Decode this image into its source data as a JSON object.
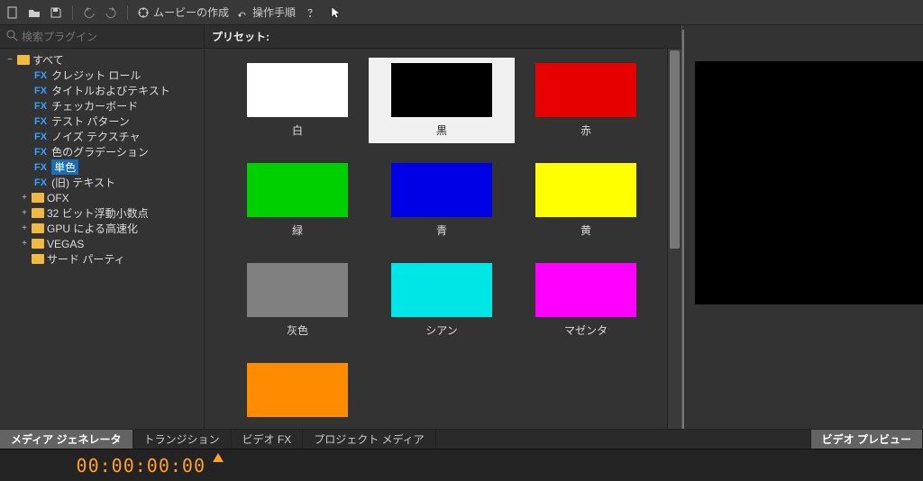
{
  "toolbar": {
    "movie_label": "ムービーの作成",
    "help_label": "操作手順"
  },
  "search": {
    "placeholder": "検索プラグイン"
  },
  "tree": {
    "root": "すべて",
    "fx_items": [
      "クレジット ロール",
      "タイトルおよびテキスト",
      "チェッカーボード",
      "テスト パターン",
      "ノイズ テクスチャ",
      "色のグラデーション",
      "単色",
      "(旧) テキスト"
    ],
    "selected_index": 6,
    "folders": [
      "OFX",
      "32 ビット浮動小数点",
      "GPU による高速化",
      "VEGAS",
      "サード パーティ"
    ]
  },
  "preset": {
    "header": "プリセット:",
    "items": [
      {
        "label": "白",
        "color": "#ffffff",
        "selected": false
      },
      {
        "label": "黒",
        "color": "#000000",
        "selected": true
      },
      {
        "label": "赤",
        "color": "#e60000",
        "selected": false
      },
      {
        "label": "緑",
        "color": "#00d000",
        "selected": false
      },
      {
        "label": "青",
        "color": "#0000e6",
        "selected": false
      },
      {
        "label": "黄",
        "color": "#ffff00",
        "selected": false
      },
      {
        "label": "灰色",
        "color": "#808080",
        "selected": false
      },
      {
        "label": "シアン",
        "color": "#00e6e6",
        "selected": false
      },
      {
        "label": "マゼンタ",
        "color": "#ff00ff",
        "selected": false
      },
      {
        "label": "",
        "color": "#ff8c00",
        "selected": false
      }
    ]
  },
  "tabs": {
    "left": [
      "メディア ジェネレータ",
      "トランジション",
      "ビデオ FX",
      "プロジェクト メディア"
    ],
    "active_left": 0,
    "right": "ビデオ プレビュー"
  },
  "timeline": {
    "timecode": "00:00:00:00"
  }
}
